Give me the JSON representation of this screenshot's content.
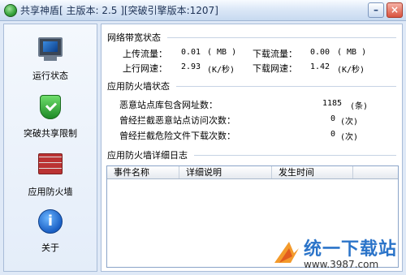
{
  "window": {
    "title": "共享神盾[ 主版本: 2.5 ][突破引擎版本:1207]",
    "minimize_icon": "minimize-icon",
    "close_icon": "close-icon"
  },
  "sidebar": {
    "items": [
      {
        "label": "运行状态",
        "icon": "monitor-icon"
      },
      {
        "label": "突破共享限制",
        "icon": "shield-icon"
      },
      {
        "label": "应用防火墙",
        "icon": "firewall-icon"
      },
      {
        "label": "关于",
        "icon": "about-icon"
      }
    ]
  },
  "network": {
    "title": "网络带宽状态",
    "upload_flow_label": "上传流量：",
    "upload_flow_value": "0.01",
    "upload_flow_unit": "( MB )",
    "download_flow_label": "下载流量：",
    "download_flow_value": "0.00",
    "download_flow_unit": "( MB )",
    "upload_speed_label": "上行网速：",
    "upload_speed_value": "2.93",
    "upload_speed_unit": "(K/秒)",
    "download_speed_label": "下载网速：",
    "download_speed_value": "1.42",
    "download_speed_unit": "(K/秒)"
  },
  "firewall": {
    "title": "应用防火墙状态",
    "rows": [
      {
        "label": "恶意站点库包含网址数：",
        "value": "1185",
        "unit": "(条)"
      },
      {
        "label": "曾经拦截恶意站点访问次数：",
        "value": "0",
        "unit": "(次)"
      },
      {
        "label": "曾经拦截危险文件下载次数：",
        "value": "0",
        "unit": "(次)"
      }
    ]
  },
  "log": {
    "title": "应用防火墙详细日志",
    "columns": [
      "事件名称",
      "详细说明",
      "发生时间"
    ]
  },
  "watermark": {
    "main": "统一下载站",
    "url": "www.3987.com"
  }
}
